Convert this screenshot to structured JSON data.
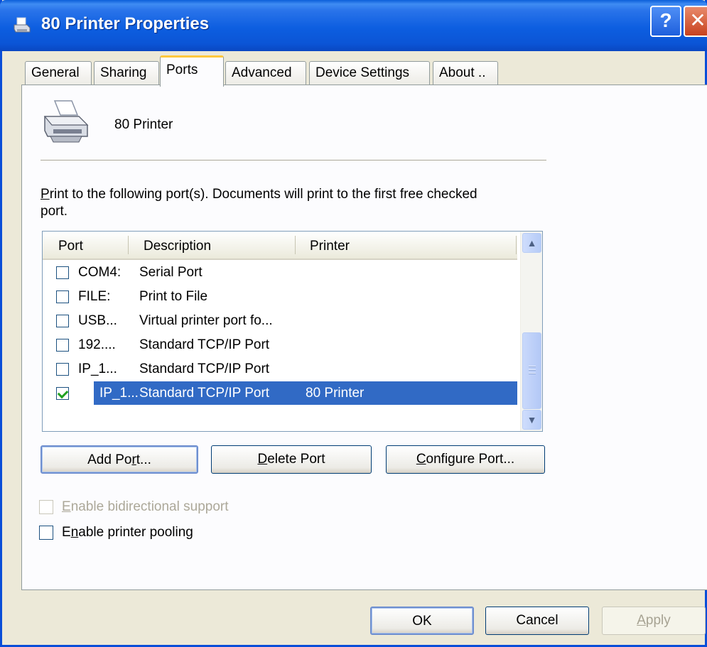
{
  "window": {
    "title": "80 Printer Properties",
    "help_label": "?",
    "close_label": "✕"
  },
  "tabs": [
    {
      "label": "General"
    },
    {
      "label": "Sharing"
    },
    {
      "label": "Ports"
    },
    {
      "label": "Advanced"
    },
    {
      "label": "Device Settings"
    },
    {
      "label": "About .."
    }
  ],
  "printer": {
    "name": "80 Printer"
  },
  "instructions": {
    "first_letter": "P",
    "rest": "rint to the following port(s). Documents will print to the first free checked port."
  },
  "ports_list": {
    "columns": {
      "port": "Port",
      "description": "Description",
      "printer": "Printer"
    },
    "rows": [
      {
        "port": "COM4:",
        "description": "Serial Port",
        "printer": "",
        "checked": false
      },
      {
        "port": "FILE:",
        "description": "Print to File",
        "printer": "",
        "checked": false
      },
      {
        "port": "USB...",
        "description": "Virtual printer port fo...",
        "printer": "",
        "checked": false
      },
      {
        "port": "192....",
        "description": "Standard TCP/IP Port",
        "printer": "",
        "checked": false
      },
      {
        "port": "IP_1...",
        "description": "Standard TCP/IP Port",
        "printer": "",
        "checked": false
      },
      {
        "port": "IP_1...",
        "description": "Standard TCP/IP Port",
        "printer": "80 Printer",
        "checked": true
      }
    ]
  },
  "buttons": {
    "add_port_pre": "Add Po",
    "add_port_key": "r",
    "add_port_post": "t...",
    "delete_port_key": "D",
    "delete_port_post": "elete Port",
    "configure_port_key": "C",
    "configure_port_post": "onfigure Port...",
    "ok": "OK",
    "cancel": "Cancel",
    "apply_key": "A",
    "apply_post": "pply"
  },
  "options": {
    "bidirectional_key": "E",
    "bidirectional_post": "nable bidirectional support",
    "pooling_pre": "E",
    "pooling_key": "n",
    "pooling_post": "able printer pooling"
  }
}
